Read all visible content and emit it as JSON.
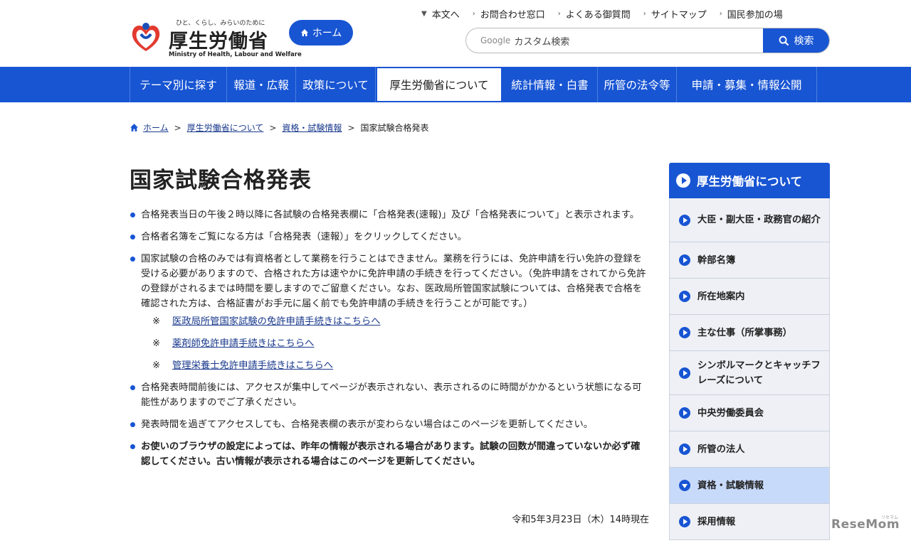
{
  "header": {
    "tagline": "ひと、くらし、みらいのために",
    "org_name": "厚生労働省",
    "org_name_en": "Ministry of Health, Labour and Welfare",
    "home_button": "ホーム",
    "util_links": [
      "本文へ",
      "お問合わせ窓口",
      "よくある御質問",
      "サイトマップ",
      "国民参加の場"
    ],
    "search": {
      "brand": "Google",
      "placeholder": "カスタム検索",
      "button": "検索"
    }
  },
  "gnav": {
    "items": [
      "テーマ別に探す",
      "報道・広報",
      "政策について",
      "厚生労働省について",
      "統計情報・白書",
      "所管の法令等",
      "申請・募集・情報公開"
    ],
    "active_index": 3
  },
  "breadcrumb": [
    "ホーム",
    "厚生労働省について",
    "資格・試験情報",
    "国家試験合格発表"
  ],
  "page": {
    "title": "国家試験合格発表",
    "bullets": [
      "合格発表当日の午後２時以降に各試験の合格発表欄に「合格発表(速報)」及び「合格発表について」と表示されます。",
      "合格者名簿をご覧になる方は「合格発表（速報）」をクリックしてください。",
      "国家試験の合格のみでは有資格者として業務を行うことはできません。業務を行うには、免許申請を行い免許の登録を受ける必要がありますので、合格された方は速やかに免許申請の手続きを行ってください。（免許申請をされてから免許の登録がされるまでは時間を要しますのでご留意ください。なお、医政局所管国家試験については、合格発表で合格を確認された方は、合格証書がお手元に届く前でも免許申請の手続きを行うことが可能です。）",
      "合格発表時間前後には、アクセスが集中してページが表示されない、表示されるのに時間がかかるという状態になる可能性がありますのでご了承ください。",
      "発表時間を過ぎてアクセスしても、合格発表欄の表示が変わらない場合はこのページを更新してください。",
      "お使いのブラウザの設定によっては、昨年の情報が表示される場合があります。試験の回数が間違っていないか必ず確認してください。古い情報が表示される場合はこのページを更新してください。"
    ],
    "note_mark": "※",
    "notes": [
      "医政局所管国家試験の免許申請手続きはこちらへ",
      "薬剤師免許申請手続きはこちらへ",
      "管理栄養士免許申請手続きはこちらへ"
    ],
    "date": "令和5年3月23日（木）14時現在"
  },
  "side": {
    "heading": "厚生労働省について",
    "items": [
      "大臣・副大臣・政務官の紹介",
      "幹部名簿",
      "所在地案内",
      "主な仕事（所掌事務）",
      "シンボルマークとキャッチフレーズについて",
      "中央労働委員会",
      "所管の法人",
      "資格・試験情報",
      "採用情報"
    ],
    "open_index": 7
  },
  "watermark": {
    "brand": "ReseMom",
    "sub": "リセマム"
  },
  "colors": {
    "primary": "#1855d3",
    "side_bg": "#eef0f5",
    "side_active": "#c8dafa",
    "link": "#1a3a8c"
  }
}
